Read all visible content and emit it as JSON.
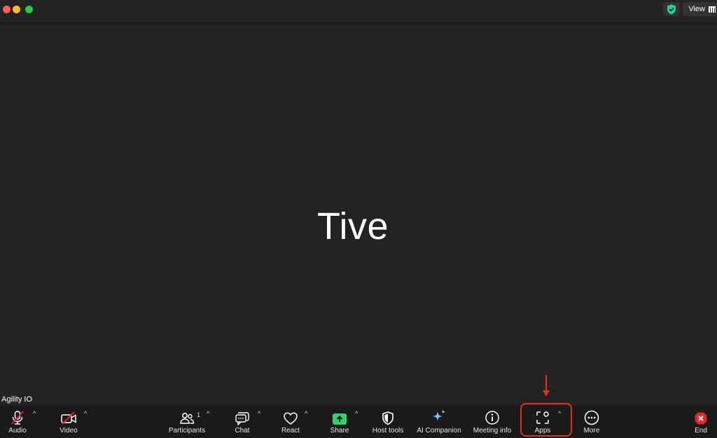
{
  "titlebar": {
    "view_label": "View",
    "security_icon": "shield-check-icon",
    "security_color": "#23d18b"
  },
  "stage": {
    "participant_display_name": "Tive",
    "name_tag": "Agility IO"
  },
  "toolbar": {
    "audio_label": "Audio",
    "video_label": "Video",
    "participants_label": "Participants",
    "participants_count": "1",
    "chat_label": "Chat",
    "react_label": "React",
    "share_label": "Share",
    "host_tools_label": "Host tools",
    "ai_companion_label": "AI Companion",
    "meeting_info_label": "Meeting info",
    "apps_label": "Apps",
    "more_label": "More",
    "end_label": "End",
    "caret": "^"
  },
  "colors": {
    "share_green": "#2fd46f",
    "end_red": "#e5242b",
    "highlight_red": "#e0311a",
    "muted_slash": "#e5242b"
  }
}
